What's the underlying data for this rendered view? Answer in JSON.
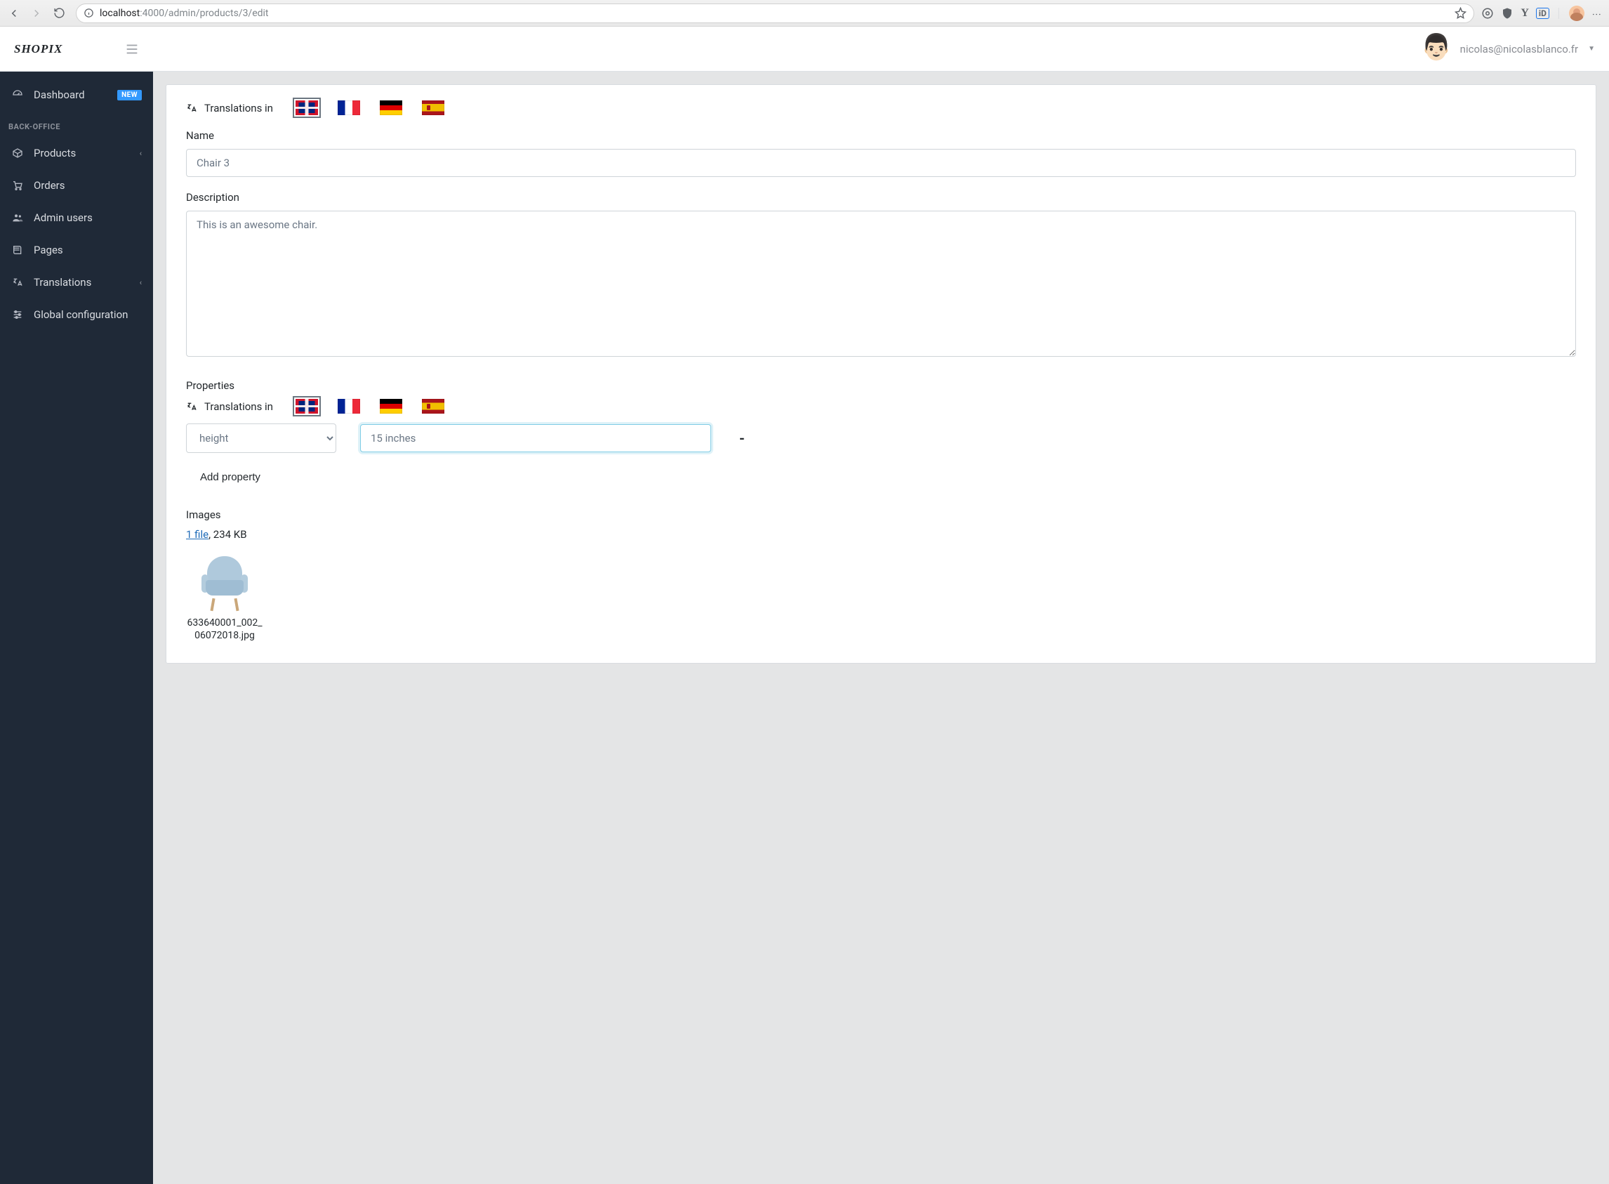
{
  "browser": {
    "url_prefix": "localhost",
    "url_rest": ":4000/admin/products/3/edit"
  },
  "topbar": {
    "logo": "SHOPIX",
    "user_email": "nicolas@nicolasblanco.fr"
  },
  "sidebar": {
    "dashboard": "Dashboard",
    "dashboard_badge": "NEW",
    "section": "BACK-OFFICE",
    "products": "Products",
    "orders": "Orders",
    "admin_users": "Admin users",
    "pages": "Pages",
    "translations": "Translations",
    "global_config": "Global configuration"
  },
  "form": {
    "translations_label": "Translations in",
    "name_label": "Name",
    "name_value": "Chair 3",
    "description_label": "Description",
    "description_value": "This is an awesome chair.",
    "properties_label": "Properties",
    "property_key": "height",
    "property_value": "15 inches",
    "remove_symbol": "-",
    "add_property": "Add property",
    "images_label": "Images",
    "file_link": "1 file",
    "file_size_sep": ", ",
    "file_size": "234 KB",
    "thumb_filename": "633640001_002_06072018.jpg"
  }
}
